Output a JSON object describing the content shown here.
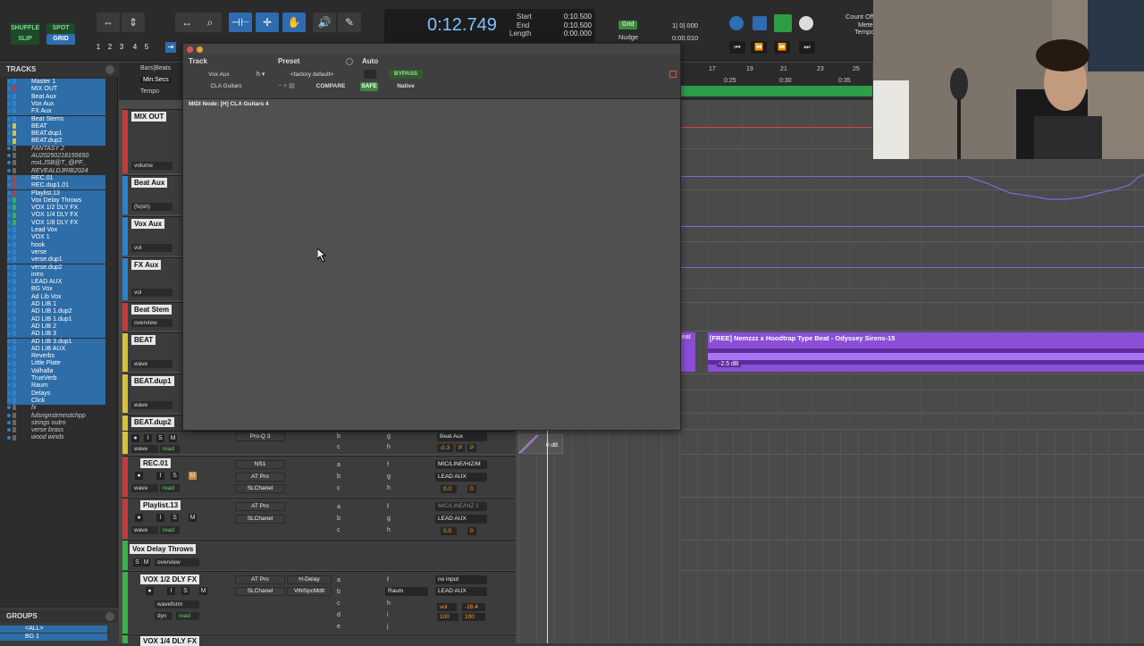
{
  "toolbar": {
    "modes": [
      "SHUFFLE",
      "SPOT",
      "SLIP",
      "GRID"
    ],
    "zoom_presets": [
      "1",
      "2",
      "3",
      "4",
      "5"
    ],
    "main_counter": "0:12.749",
    "start_label": "Start",
    "end_label": "End",
    "length_label": "Length",
    "start_value": "0:10.500",
    "end_value": "0:10.500",
    "length_value": "0:00.000",
    "grid_label": "Grid",
    "grid_value": "1| 0| 000",
    "nudge_label": "Nudge",
    "nudge_value": "0:00.010",
    "count_off_label": "Count Off",
    "meter_label": "Meter",
    "tempo_label": "Tempo"
  },
  "tracks_panel": {
    "title": "TRACKS",
    "items": [
      {
        "name": "Master 1",
        "color": "#2b83d0",
        "sel": true
      },
      {
        "name": "MIX OUT",
        "color": "#c43b3b",
        "sel": true
      },
      {
        "name": "Beat Aux",
        "color": "#2b83d0",
        "sel": true
      },
      {
        "name": "Vox Aux",
        "color": "#2b83d0",
        "sel": true
      },
      {
        "name": "FX Aux",
        "color": "#2b83d0",
        "sel": true
      },
      {
        "name": "Beat Stems",
        "color": "#2b83d0",
        "sel": true
      },
      {
        "name": "BEAT",
        "color": "#d6c23a",
        "sel": true
      },
      {
        "name": "BEAT.dup1",
        "color": "#d6c23a",
        "sel": true
      },
      {
        "name": "BEAT.dup2",
        "color": "#d6c23a",
        "sel": true
      },
      {
        "name": "FANTASY 2",
        "color": "#666",
        "sel": false
      },
      {
        "name": "AU20250218155650",
        "color": "#666",
        "sel": false
      },
      {
        "name": "mxLJSB@T_@PF_",
        "color": "#666",
        "sel": false
      },
      {
        "name": "REVEALDJRIB2024",
        "color": "#666",
        "sel": false
      },
      {
        "name": "REC.01",
        "color": "#c43b3b",
        "sel": true
      },
      {
        "name": "REC.dup1.01",
        "color": "#c43b3b",
        "sel": true
      },
      {
        "name": "Playlist.13",
        "color": "#c43b3b",
        "sel": true
      },
      {
        "name": "Vox Delay Throws",
        "color": "#3cb04a",
        "sel": true
      },
      {
        "name": "VOX 1/2 DLY FX",
        "color": "#3cb04a",
        "sel": true
      },
      {
        "name": "VOX 1/4 DLY FX",
        "color": "#3cb04a",
        "sel": true
      },
      {
        "name": "VOX 1/8 DLY FX",
        "color": "#3cb04a",
        "sel": true
      },
      {
        "name": "Lead Vox",
        "color": "#2b83d0",
        "sel": true
      },
      {
        "name": "VOX 1",
        "color": "#2b83d0",
        "sel": true
      },
      {
        "name": "hook",
        "color": "#2b83d0",
        "sel": true
      },
      {
        "name": "verse",
        "color": "#2b83d0",
        "sel": true
      },
      {
        "name": "verse.dup1",
        "color": "#2b83d0",
        "sel": true
      },
      {
        "name": "verse.dup2",
        "color": "#2b83d0",
        "sel": true
      },
      {
        "name": "intro",
        "color": "#2b83d0",
        "sel": true
      },
      {
        "name": "LEAD AUX",
        "color": "#2b83d0",
        "sel": true
      },
      {
        "name": "BG Vox",
        "color": "#2b83d0",
        "sel": true
      },
      {
        "name": "Ad Lib Vox",
        "color": "#2b83d0",
        "sel": true
      },
      {
        "name": "AD LIB 1",
        "color": "#2b83d0",
        "sel": true
      },
      {
        "name": "AD LIB 1.dup2",
        "color": "#2b83d0",
        "sel": true
      },
      {
        "name": "AD LIB 1.dup1",
        "color": "#2b83d0",
        "sel": true
      },
      {
        "name": "AD LIB 2",
        "color": "#2b83d0",
        "sel": true
      },
      {
        "name": "AD LIB 3",
        "color": "#2b83d0",
        "sel": true
      },
      {
        "name": "AD LIB 3.dup1",
        "color": "#2b83d0",
        "sel": true
      },
      {
        "name": "AD LIB AUX",
        "color": "#2b83d0",
        "sel": true
      },
      {
        "name": "Reverbs",
        "color": "#2b83d0",
        "sel": true
      },
      {
        "name": "Little Plate",
        "color": "#2b83d0",
        "sel": true
      },
      {
        "name": "Valhalla",
        "color": "#2b83d0",
        "sel": true
      },
      {
        "name": "TrueVerb",
        "color": "#2b83d0",
        "sel": true
      },
      {
        "name": "Raum",
        "color": "#2b83d0",
        "sel": true
      },
      {
        "name": "Delays",
        "color": "#2b83d0",
        "sel": true
      },
      {
        "name": "Click",
        "color": "#2b83d0",
        "sel": true
      },
      {
        "name": "fx",
        "color": "#666",
        "sel": false
      },
      {
        "name": "fulsngnstrmnstchpp",
        "color": "#666",
        "sel": false
      },
      {
        "name": "strings outro",
        "color": "#666",
        "sel": false
      },
      {
        "name": "verse brass",
        "color": "#666",
        "sel": false
      },
      {
        "name": "wood winds",
        "color": "#666",
        "sel": false
      }
    ]
  },
  "groups_panel": {
    "title": "GROUPS",
    "items": [
      "<ALL>",
      "BG 1"
    ]
  },
  "ruler": {
    "bars_beats_label": "Bars|Beats",
    "min_secs_label": "Min:Secs",
    "tempo_label": "Tempo",
    "bar_numbers": [
      "17",
      "19",
      "21",
      "23",
      "25"
    ],
    "time_labels": [
      "0:25",
      "0:30",
      "0:35"
    ]
  },
  "plugin_window": {
    "track_label": "Track",
    "preset_label": "Preset",
    "auto_label": "Auto",
    "track_select": "Vox Aux",
    "insert_select": "CLA Guitars",
    "preset_select": "<factory default>",
    "bypass_label": "BYPASS",
    "compare_label": "COMPARE",
    "safe_label": "SAFE",
    "native_label": "Native",
    "midi_node": "MIDI Node: [H] CLA Guitars 4"
  },
  "track_headers": [
    {
      "name": "MIX OUT",
      "color": "#c43b3b",
      "mode": "volume"
    },
    {
      "name": "Beat Aux",
      "color": "#2b83d0",
      "mode": "(fx|sh)"
    },
    {
      "name": "Vox Aux",
      "color": "#2b83d0",
      "mode": "vol"
    },
    {
      "name": "FX Aux",
      "color": "#2b83d0",
      "mode": "vol"
    },
    {
      "name": "Beat Stem",
      "color": "#c43b3b",
      "mode": "overview"
    },
    {
      "name": "BEAT",
      "color": "#d6c23a",
      "mode": "wave"
    },
    {
      "name": "BEAT.dup1",
      "color": "#d6c23a",
      "mode": "wave"
    },
    {
      "name": "BEAT.dup2",
      "color": "#d6c23a",
      "mode": "wave"
    },
    {
      "name": "REC.01",
      "color": "#c43b3b",
      "mode": "wave"
    },
    {
      "name": "Playlist.13",
      "color": "#c43b3b",
      "mode": "wave"
    }
  ],
  "mix_rows": {
    "beat_dup2": {
      "insert": "Pro-Q 3",
      "io": "Beat Aux",
      "vol": "-0.3",
      "pan1": "P",
      "pan2": "P"
    },
    "rec01": {
      "inserts": [
        "NS1",
        "AT Pro",
        "SLChanel"
      ],
      "io_in": "MIC/LINE/HIZ/M",
      "io_out": "LEAD AUX",
      "vol": "0.0",
      "pan": "0"
    },
    "playlist13": {
      "inserts": [
        "AT Pro",
        "SLChanel"
      ],
      "io_in": "MIC/LINE/HIZ 1",
      "io_out": "LEAD AUX",
      "vol": "0.0",
      "pan": "0"
    },
    "vox_delay_throws": {
      "name": "Vox Delay Throws",
      "mode": "overview"
    },
    "vox_half_dly": {
      "name": "VOX 1/2 DLY FX",
      "inserts_a": [
        "AT Pro",
        "SLChanel"
      ],
      "inserts_b": [
        "H-Delay",
        "VlhlSpcMdlt"
      ],
      "send": "Raum",
      "io_in": "no input",
      "io_out": "LEAD AUX",
      "vol_label": "vol",
      "vol": "-16.4",
      "pan_l": "100",
      "pan_r": "100",
      "mode1": "waveform",
      "mode2": "dyn",
      "mode3": "read"
    },
    "vox_quarter_dly": {
      "name": "VOX 1/4 DLY FX"
    }
  },
  "letters_a_j": [
    "a",
    "b",
    "c",
    "d",
    "e",
    "f",
    "g",
    "h",
    "i",
    "j"
  ],
  "clip": {
    "title": "[FREE] Nemzzz x Hoodtrap Type Beat - Odyssey Sirens-15",
    "gain": "-2.5 dB",
    "small_label": "eat",
    "fade_gain": "0 dB"
  },
  "colors": {
    "accent_blue": "#2e6bb0",
    "counter_blue": "#7fc3ff",
    "clip_purple": "#8a4fd6",
    "automation": "#7b6ae0",
    "green": "#2e9d47"
  }
}
